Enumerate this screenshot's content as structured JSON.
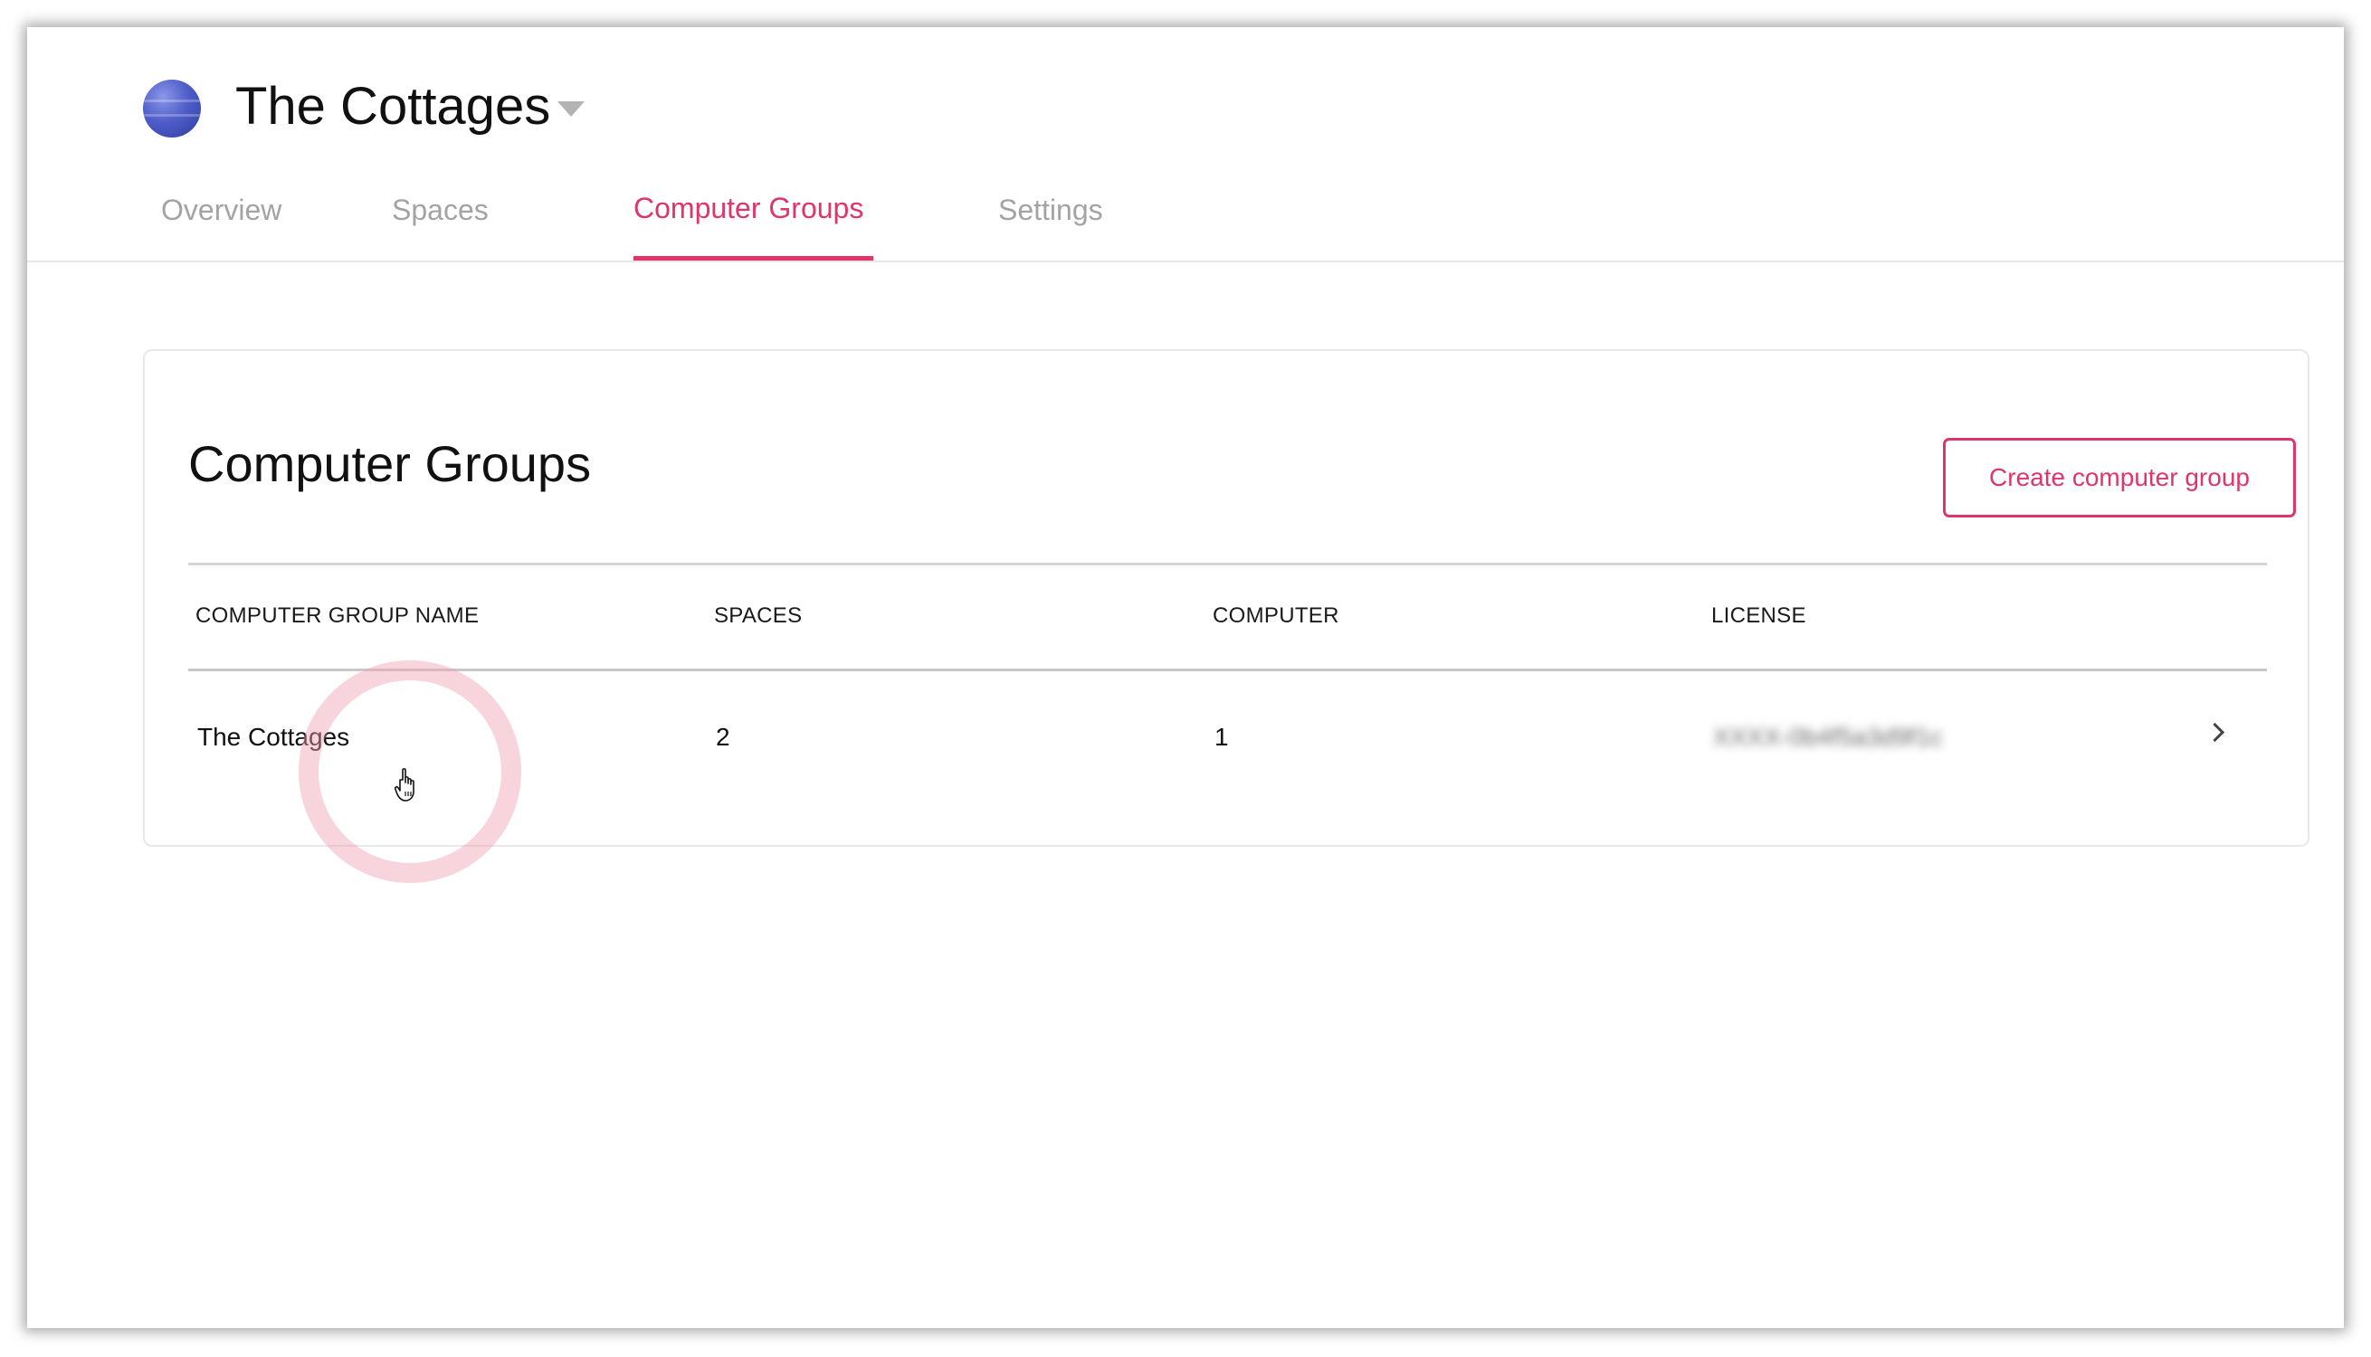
{
  "header": {
    "org_name": "The Cottages",
    "avatar_colors": [
      "#8a96e8",
      "#4f5ec9",
      "#2f3c9e"
    ],
    "tabs": [
      {
        "label": "Overview",
        "active": false
      },
      {
        "label": "Spaces",
        "active": false
      },
      {
        "label": "Computer Groups",
        "active": true
      },
      {
        "label": "Settings",
        "active": false
      }
    ]
  },
  "main": {
    "title": "Computer Groups",
    "create_button_label": "Create computer group",
    "table": {
      "columns": [
        "COMPUTER GROUP NAME",
        "SPACES",
        "COMPUTER",
        "LICENSE"
      ],
      "rows": [
        {
          "name": "The Cottages",
          "spaces": "2",
          "computer": "1",
          "license": "XXXX-0b4f5a3d9f1c"
        }
      ]
    }
  },
  "colors": {
    "accent": "#e0356b",
    "inactive_tab": "#a3a3a3",
    "text": "#111111"
  },
  "icons": {
    "caret": "caret-down-icon",
    "row_chevron": "chevron-right-icon",
    "cursor": "hand-pointer-icon"
  }
}
